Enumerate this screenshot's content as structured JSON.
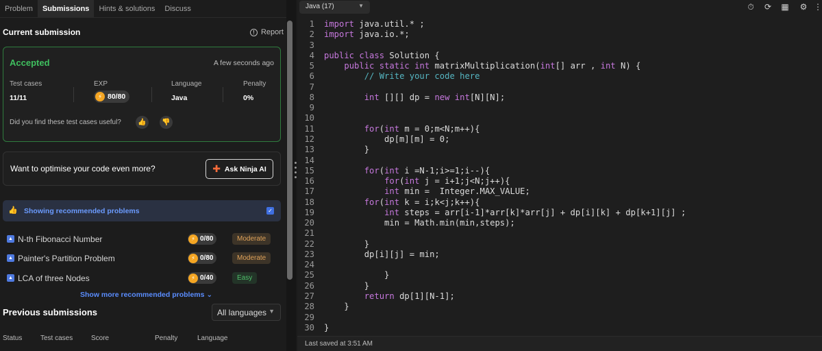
{
  "tabs": [
    "Problem",
    "Submissions",
    "Hints & solutions",
    "Discuss"
  ],
  "current_submission": {
    "title": "Current submission",
    "report": "Report",
    "status": "Accepted",
    "time": "A few seconds ago",
    "stats": {
      "test_cases_label": "Test cases",
      "test_cases_value": "11/11",
      "exp_label": "EXP",
      "exp_value": "80/80",
      "language_label": "Language",
      "language_value": "Java",
      "penalty_label": "Penalty",
      "penalty_value": "0%"
    },
    "useful_question": "Did you find these test cases useful?"
  },
  "ninja": {
    "question": "Want to optimise your code even more?",
    "button": "Ask Ninja AI"
  },
  "recommended": {
    "label": "Showing recommended problems",
    "problems": [
      {
        "name": "N-th Fibonacci Number",
        "score": "0/80",
        "difficulty": "Moderate"
      },
      {
        "name": "Painter's Partition Problem",
        "score": "0/80",
        "difficulty": "Moderate"
      },
      {
        "name": "LCA of three Nodes",
        "score": "0/40",
        "difficulty": "Easy"
      }
    ],
    "show_more": "Show more recommended problems"
  },
  "previous": {
    "title": "Previous submissions",
    "filter": "All languages",
    "columns": [
      "Status",
      "Test cases",
      "Score",
      "Penalty",
      "Language"
    ]
  },
  "editor": {
    "language": "Java (17)",
    "lines": [
      "import java.util.* ;",
      "import java.io.*;",
      "",
      "public class Solution {",
      "    public static int matrixMultiplication(int[] arr , int N) {",
      "        // Write your code here",
      "",
      "        int [][] dp = new int[N][N];",
      "",
      "",
      "        for(int m = 0;m<N;m++){",
      "            dp[m][m] = 0;",
      "        }",
      "",
      "        for(int i =N-1;i>=1;i--){",
      "            for(int j = i+1;j<N;j++){",
      "            int min =  Integer.MAX_VALUE;",
      "        for(int k = i;k<j;k++){",
      "            int steps = arr[i-1]*arr[k]*arr[j] + dp[i][k] + dp[k+1][j] ;",
      "            min = Math.min(min,steps);",
      "",
      "        }",
      "        dp[i][j] = min;",
      "",
      "            }",
      "        }",
      "        return dp[1][N-1];",
      "    }",
      "",
      "}"
    ],
    "status": "Last saved at 3:51 AM"
  },
  "colors": {
    "keyword": "#c678dd",
    "comment": "#56b6c2",
    "accepted": "#3fbf5f",
    "link": "#5a8dff"
  },
  "icons": [
    "timer-icon",
    "reset-icon",
    "layout-icon",
    "settings-icon",
    "more-icon"
  ]
}
